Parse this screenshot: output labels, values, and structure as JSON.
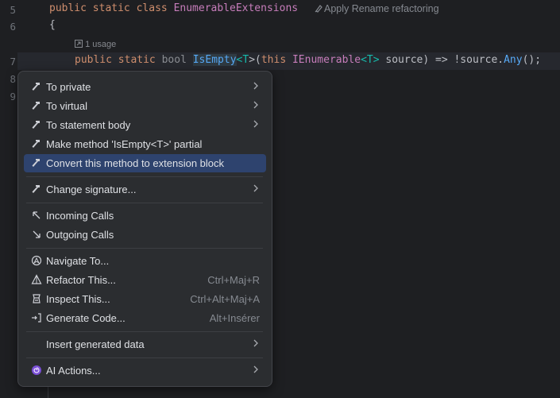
{
  "editor": {
    "line_numbers": [
      "5",
      "6",
      "7",
      "8",
      "9"
    ],
    "line5": {
      "kw1": "public",
      "kw2": "static",
      "kw3": "class",
      "class_name": "EnumerableExtensions",
      "hint": "Apply Rename refactoring"
    },
    "line6": {
      "brace": "{"
    },
    "usage_hint": "1 usage",
    "line7": {
      "kw1": "public",
      "kw2": "static",
      "type": "bool",
      "method": "IsEmpty",
      "tparam_open": "<",
      "tparam": "T",
      "tparam_close": ">(",
      "this_kw": "this",
      "iface": "IEnumerable",
      "lt": "<",
      "t2": "T",
      "gt": ">",
      "param": " source) => !source.",
      "call": "Any",
      "end": "();"
    }
  },
  "menu": {
    "items": [
      {
        "label": "To private",
        "icon": "hammer-icon",
        "submenu": true
      },
      {
        "label": "To virtual",
        "icon": "hammer-icon",
        "submenu": true
      },
      {
        "label": "To statement body",
        "icon": "hammer-icon",
        "submenu": true
      },
      {
        "label": "Make method 'IsEmpty<T>' partial",
        "icon": "hammer-icon"
      },
      {
        "label": "Convert this method to extension block",
        "icon": "hammer-icon",
        "selected": true
      },
      {
        "label": "Change signature...",
        "icon": "hammer-icon",
        "submenu": true
      },
      {
        "label": "Incoming Calls",
        "icon": "arrow-up-left-icon"
      },
      {
        "label": "Outgoing Calls",
        "icon": "arrow-down-right-icon"
      },
      {
        "label": "Navigate To...",
        "icon": "navigate-icon"
      },
      {
        "label": "Refactor This...",
        "icon": "refactor-icon",
        "shortcut": "Ctrl+Maj+R"
      },
      {
        "label": "Inspect This...",
        "icon": "inspect-icon",
        "shortcut": "Ctrl+Alt+Maj+A"
      },
      {
        "label": "Generate Code...",
        "icon": "generate-icon",
        "shortcut": "Alt+Insérer"
      },
      {
        "label": "Insert generated data",
        "icon": "",
        "submenu": true
      },
      {
        "label": "AI Actions...",
        "icon": "ai-spiral-icon",
        "submenu": true
      }
    ]
  },
  "colors": {
    "editor_bg": "#1e1f22",
    "menu_bg": "#2b2d30",
    "selection": "#2e436e",
    "keyword": "#cf8e6d"
  }
}
